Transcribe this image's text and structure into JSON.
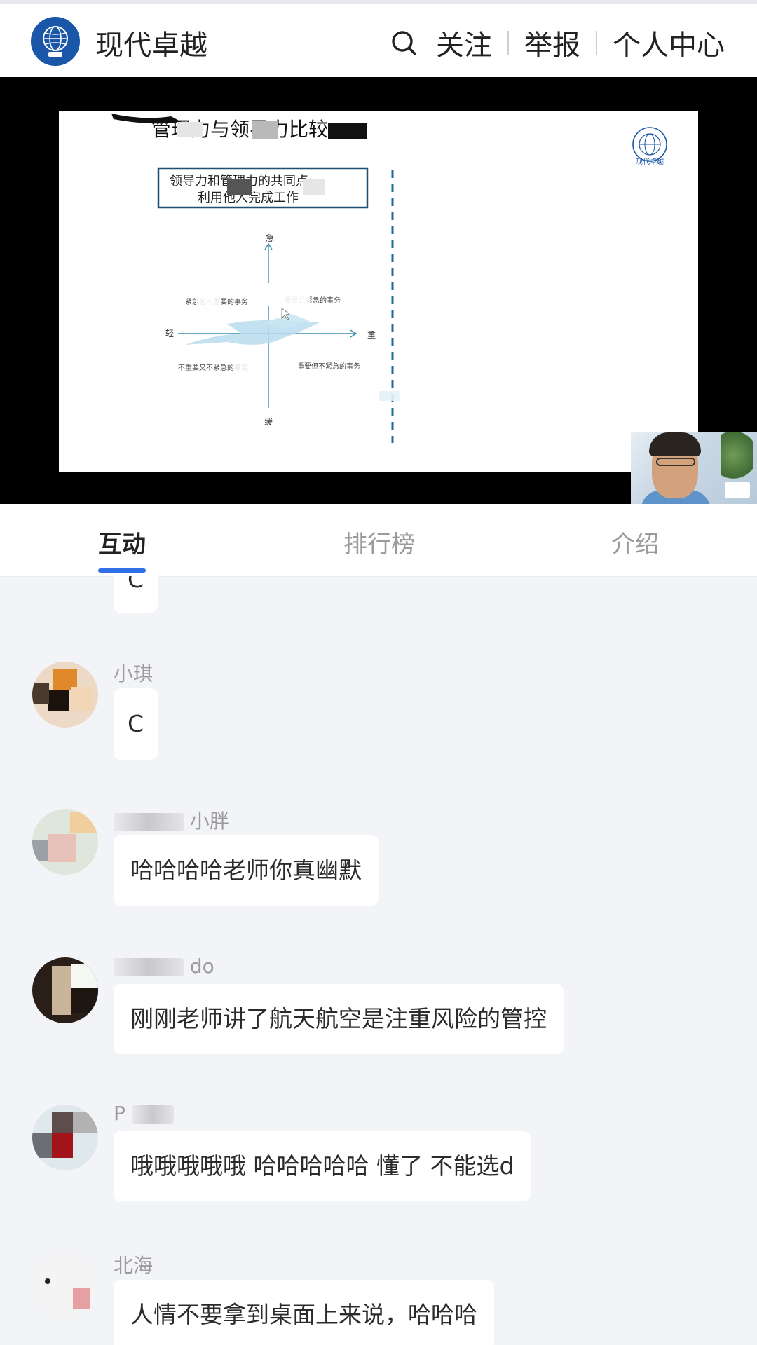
{
  "header": {
    "brand": "现代卓越",
    "follow_label": "关注",
    "report_label": "举报",
    "profile_label": "个人中心",
    "logo_icon": "globe-logo-icon",
    "search_icon": "search-icon"
  },
  "slide": {
    "title": "管理力与领导力比较",
    "box_text_1": "领导力和管理力的共同点:",
    "box_text_2": "利用他人完成工作",
    "axis_top": "急",
    "axis_bottom": "缓",
    "axis_left": "轻",
    "axis_right": "重",
    "quad_tl": "紧急但不重要的事务",
    "quad_tr": "重要且紧急的事务",
    "quad_bl": "不重要又不紧急的事务",
    "quad_br": "重要但不紧急的事务",
    "corner_logo_text": "现代卓越"
  },
  "tabs": {
    "interaction": "互动",
    "ranking": "排行榜",
    "intro": "介绍"
  },
  "messages": [
    {
      "name": "",
      "text": "C",
      "partial": true
    },
    {
      "name": "小琪",
      "text": "C"
    },
    {
      "name": "小胖",
      "text": "哈哈哈哈老师你真幽默"
    },
    {
      "name": "do",
      "text": "刚刚老师讲了航天航空是注重风险的管控"
    },
    {
      "name": "P",
      "text": "哦哦哦哦哦 哈哈哈哈哈 懂了 不能选d"
    },
    {
      "name": "北海",
      "text": "人情不要拿到桌面上来说，哈哈哈"
    }
  ],
  "colors": {
    "accent": "#2f6fe8",
    "brand_blue": "#1a57a8",
    "page_bg": "#f3f4f8"
  }
}
